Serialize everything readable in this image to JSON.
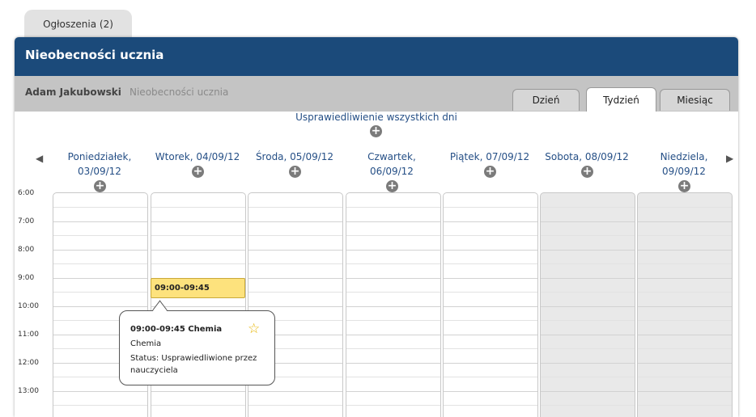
{
  "announcements_tab": "Ogłoszenia (2)",
  "panel": {
    "title": "Nieobecności ucznia"
  },
  "breadcrumb": {
    "student": "Adam Jakubowski",
    "page": "Nieobecności ucznia"
  },
  "view_tabs": [
    {
      "label": "Dzień",
      "active": false
    },
    {
      "label": "Tydzień",
      "active": true
    },
    {
      "label": "Miesiąc",
      "active": false
    }
  ],
  "justify_all": "Usprawiedliwienie wszystkich dni",
  "nav": {
    "prev": "◀",
    "next": "▶"
  },
  "days": [
    {
      "line1": "Poniedziałek,",
      "line2": "03/09/12"
    },
    {
      "line1": "Wtorek, 04/09/12",
      "line2": ""
    },
    {
      "line1": "Środa, 05/09/12",
      "line2": ""
    },
    {
      "line1": "Czwartek,",
      "line2": "06/09/12"
    },
    {
      "line1": "Piątek, 07/09/12",
      "line2": ""
    },
    {
      "line1": "Sobota, 08/09/12",
      "line2": ""
    },
    {
      "line1": "Niedziela,",
      "line2": "09/09/12"
    }
  ],
  "times": [
    "6:00",
    "7:00",
    "8:00",
    "9:00",
    "10:00",
    "11:00",
    "12:00",
    "13:00"
  ],
  "event": {
    "label": "09:00-09:45"
  },
  "popup": {
    "title": "09:00-09:45 Chemia",
    "subject": "Chemia",
    "status": "Status: Usprawiedliwione przez nauczyciela"
  },
  "icons": {
    "add": "plus-circle-icon",
    "favorite": "star-icon"
  },
  "colors": {
    "header": "#1b4a7a",
    "event": "#fde27d",
    "link": "#254f86"
  }
}
